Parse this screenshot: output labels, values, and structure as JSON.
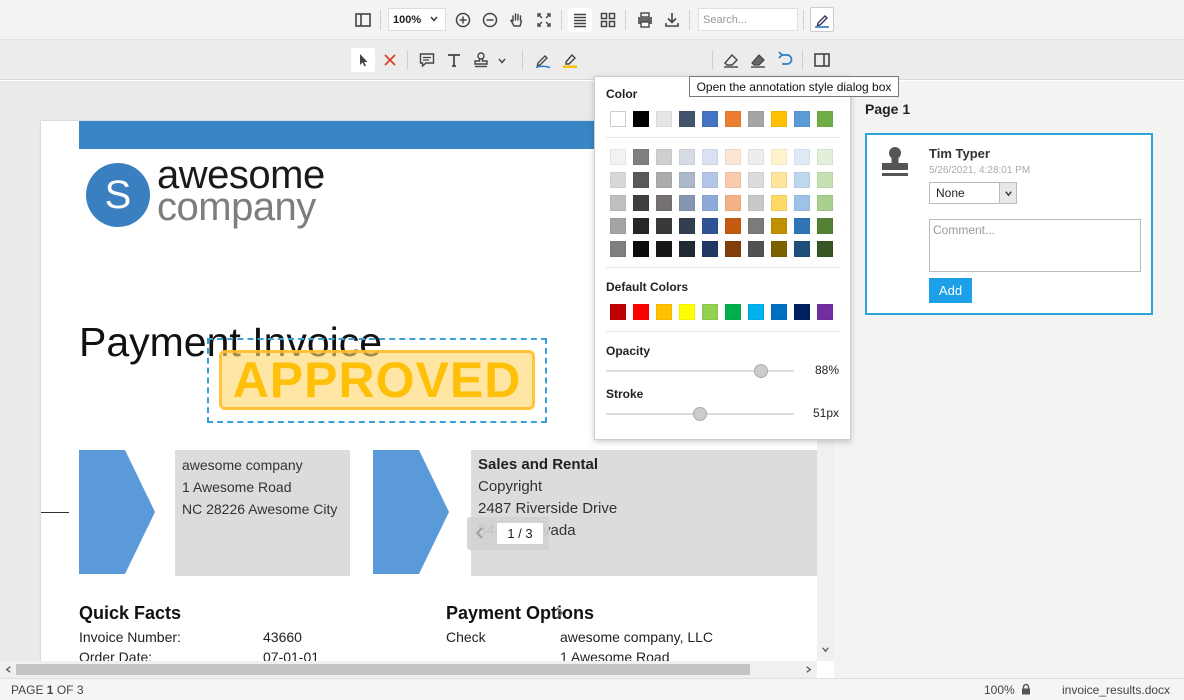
{
  "toolbar": {
    "zoom_value": "100%",
    "search_placeholder": "Search..."
  },
  "annotation_toolbar": {
    "font_button_label": "Aa"
  },
  "tooltip": {
    "text": "Open the annotation style dialog box"
  },
  "document": {
    "logo_letter": "S",
    "logo_line1": "awesome",
    "logo_line2": "company",
    "title": "Payment Invoice",
    "stamp_text": "APPROVED",
    "address_left": {
      "line1": "awesome company",
      "line2": "1 Awesome Road",
      "line3": "NC 28226 Awesome City"
    },
    "address_right": {
      "line1": "Sales and Rental",
      "line2": "Copyright",
      "line3": "2487 Riverside Drive",
      "line4": "84407 Nevada"
    },
    "quick_facts": {
      "heading": "Quick Facts",
      "rows": [
        {
          "label": "Invoice Number:",
          "value": "43660"
        },
        {
          "label": "Order Date:",
          "value": "07-01-01"
        }
      ]
    },
    "payment_options": {
      "heading": "Payment Options",
      "rows": [
        {
          "label": "Check",
          "value": "awesome company, LLC"
        },
        {
          "label": "",
          "value": "1 Awesome Road"
        }
      ]
    },
    "pager": "1 / 3"
  },
  "style_popup": {
    "color_heading": "Color",
    "top_colors": [
      "#ffffff",
      "#000000",
      "#e7e6e6",
      "#44546a",
      "#4472c4",
      "#ed7d31",
      "#a5a5a5",
      "#ffc000",
      "#5b9bd5",
      "#70ad47"
    ],
    "shade_rows": [
      [
        "#f2f2f2",
        "#7f7f7f",
        "#d0cece",
        "#d6dce4",
        "#d9e2f3",
        "#fbe5d5",
        "#ededed",
        "#fff2cc",
        "#deebf6",
        "#e2efd9"
      ],
      [
        "#d8d8d8",
        "#595959",
        "#aeabab",
        "#adb9ca",
        "#b4c6e7",
        "#f7cbac",
        "#dbdbdb",
        "#fee599",
        "#bdd7ee",
        "#c5e0b3"
      ],
      [
        "#bfbfbf",
        "#3f3f3f",
        "#767171",
        "#8496b0",
        "#8eaadb",
        "#f4b183",
        "#c9c9c9",
        "#ffd965",
        "#9cc3e5",
        "#a8d08d"
      ],
      [
        "#a5a5a5",
        "#262626",
        "#3a3838",
        "#323f4f",
        "#2f5496",
        "#c55a11",
        "#7b7b7b",
        "#bf9000",
        "#2e75b5",
        "#538135"
      ],
      [
        "#7f7f7f",
        "#0c0c0c",
        "#171616",
        "#222a35",
        "#1f3864",
        "#833c0b",
        "#525252",
        "#7f6000",
        "#1e4e79",
        "#375623"
      ]
    ],
    "default_heading": "Default Colors",
    "default_colors": [
      "#c00000",
      "#ff0000",
      "#ffc000",
      "#ffff00",
      "#92d050",
      "#00b050",
      "#00b0f0",
      "#0070c0",
      "#002060",
      "#7030a0"
    ],
    "opacity_label": "Opacity",
    "opacity_value": "88%",
    "opacity_level": 0.85,
    "stroke_label": "Stroke",
    "stroke_value": "51px",
    "stroke_level": 0.5
  },
  "side_panel": {
    "page_label": "Page 1",
    "author": "Tim Typer",
    "timestamp": "5/26/2021, 4:28:01 PM",
    "status_value": "None",
    "comment_placeholder": "Comment...",
    "add_label": "Add"
  },
  "statusbar": {
    "page_prefix": "PAGE ",
    "page_current": "1",
    "page_suffix": " OF 3",
    "zoom": "100%",
    "filename": "invoice_results.docx"
  }
}
